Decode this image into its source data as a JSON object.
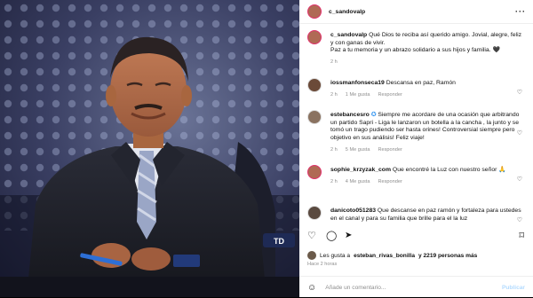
{
  "post": {
    "username": "c_sandovalp",
    "more_icon": "more-horizontal-icon"
  },
  "comments": [
    {
      "username": "c_sandovalp",
      "text": "Qué Dios te reciba así querido amigo. Jovial, alegre, feliz y con ganas de vivir.",
      "text2": "Paz a tu memoria y un abrazo solidario a sus hijos y familia. 🖤",
      "time": "2 h"
    },
    {
      "username": "iossmanfonseca19",
      "text": "Descansa en paz, Ramón",
      "time": "2 h",
      "likes": "1 Me gusta",
      "reply": "Responder"
    },
    {
      "username": "estebancesro",
      "text": "Siempre me acordare de una ocasión que arbitrando un partido Sapri - Liga le lanzaron un botella a la cancha , la junto y se tomó un trago pudiendo ser hasta orines! Controversial siempre pero objetivo en sus análisis! Feliz viaje!",
      "time": "2 h",
      "likes": "5 Me gusta",
      "reply": "Responder"
    },
    {
      "username": "sophie_krzyzak_com",
      "text": "Que encontré la Luz con nuestro señor 🙏",
      "time": "2 h",
      "likes": "4 Me gusta",
      "reply": "Responder"
    },
    {
      "username": "danicoto051283",
      "text": "Que descanse en paz ramón y fortaleza para ustedes en el canal y para su familia que brille para el la luz"
    }
  ],
  "footer": {
    "likes_prefix": "Les gusta a",
    "liker": "esteban_rivas_bonilla",
    "likes_suffix": "y 2219 personas más",
    "ago": "Hace 2 horas",
    "comment_placeholder": "Añade un comentario...",
    "post_label": "Publicar"
  },
  "photo": {
    "logo_text": "TD"
  }
}
